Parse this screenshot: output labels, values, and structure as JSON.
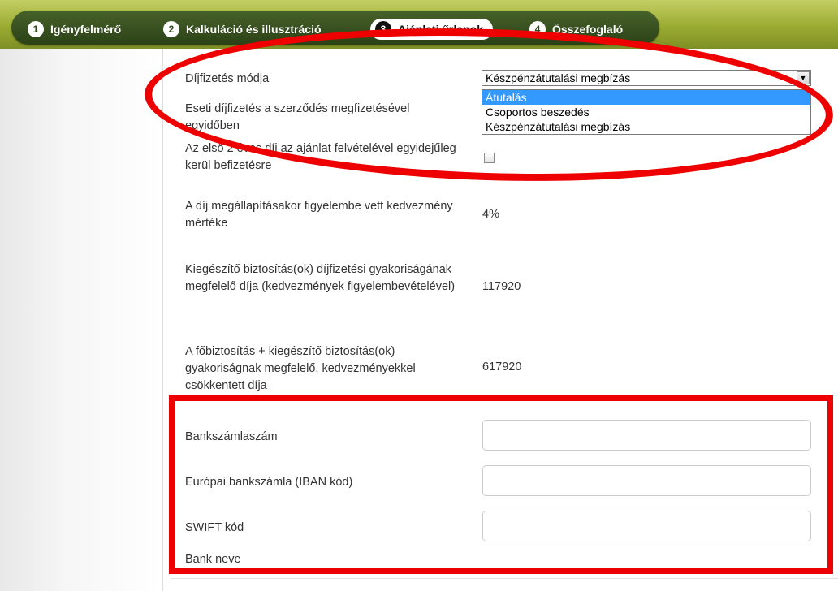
{
  "steps": [
    {
      "num": "1",
      "label": "Igényfelmérő"
    },
    {
      "num": "2",
      "label": "Kalkuláció és illusztráció"
    },
    {
      "num": "3",
      "label": "Ajánlati űrlapok"
    },
    {
      "num": "4",
      "label": "Összefoglaló"
    }
  ],
  "form": {
    "payment_method_label": "Díjfizetés módja",
    "payment_method_value": "Készpénzátutalási megbízás",
    "payment_options": [
      "Átutalás",
      "Csoportos beszedés",
      "Készpénzátutalási megbízás"
    ],
    "occasional_payment_label": "Eseti díjfizetés a szerződés megfizetésével egyidőben",
    "first_premium_label": "Az első 2 éves díj az ajánlat felvételével egyidejűleg kerül befizetésre",
    "discount_label": "A díj megállapításakor figyelembe vett kedvezmény mértéke",
    "discount_value": "4%",
    "supplementary_label": "Kiegészítő biztosítás(ok) díjfizetési gyakoriságának megfelelő díja (kedvezmények figyelembevételével)",
    "supplementary_value": "117920",
    "total_label": "A főbiztosítás + kiegészítő biztosítás(ok) gyakoriságnak megfelelő, kedvezményekkel csökkentett díja",
    "total_value": "617920",
    "bank_account_label": "Bankszámlaszám",
    "iban_label": "Európai bankszámla (IBAN kód)",
    "swift_label": "SWIFT kód",
    "bank_name_label": "Bank neve"
  },
  "colors": {
    "annotation": "#ee0000",
    "nav_background": "#2b4217",
    "header_green": "#9aab32",
    "selected_option": "#3399ff"
  }
}
